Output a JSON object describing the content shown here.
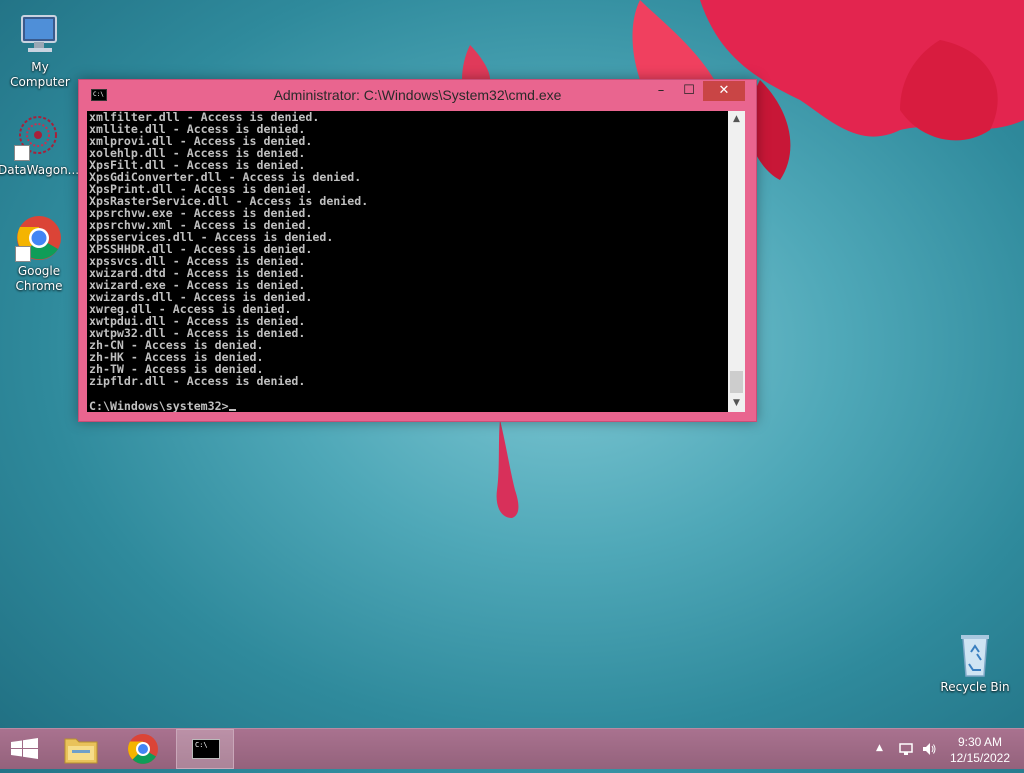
{
  "desktop": {
    "icons": [
      {
        "label": "My Computer",
        "name": "my-computer"
      },
      {
        "label": "DataWagon...",
        "name": "datawagon"
      },
      {
        "label": "Google Chrome",
        "name": "google-chrome"
      },
      {
        "label": "Recycle Bin",
        "name": "recycle-bin"
      }
    ]
  },
  "window": {
    "title": "Administrator:  C:\\Windows\\System32\\cmd.exe",
    "icon_text": "C:\\",
    "minimize": "–",
    "maximize": "☐",
    "close": "✕"
  },
  "console": {
    "lines": [
      "xmlfilter.dll - Access is denied.",
      "xmllite.dll - Access is denied.",
      "xmlprovi.dll - Access is denied.",
      "xolehlp.dll - Access is denied.",
      "XpsFilt.dll - Access is denied.",
      "XpsGdiConverter.dll - Access is denied.",
      "XpsPrint.dll - Access is denied.",
      "XpsRasterService.dll - Access is denied.",
      "xpsrchvw.exe - Access is denied.",
      "xpsrchvw.xml - Access is denied.",
      "xpsservices.dll - Access is denied.",
      "XPSSHHDR.dll - Access is denied.",
      "xpssvcs.dll - Access is denied.",
      "xwizard.dtd - Access is denied.",
      "xwizard.exe - Access is denied.",
      "xwizards.dll - Access is denied.",
      "xwreg.dll - Access is denied.",
      "xwtpdui.dll - Access is denied.",
      "xwtpw32.dll - Access is denied.",
      "zh-CN - Access is denied.",
      "zh-HK - Access is denied.",
      "zh-TW - Access is denied.",
      "zipfldr.dll - Access is denied."
    ],
    "prompt": "C:\\Windows\\system32>"
  },
  "taskbar": {
    "time": "9:30 AM",
    "date": "12/15/2022",
    "cmd_icon_text": "C:\\"
  }
}
